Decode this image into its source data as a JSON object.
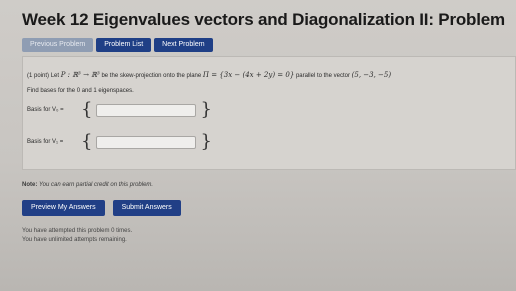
{
  "page_title": "Week 12 Eigenvalues vectors and Diagonalization II: Problem",
  "nav": {
    "previous": "Previous Problem",
    "list": "Problem List",
    "next": "Next Problem"
  },
  "problem": {
    "points": "(1 point)",
    "text_lead": "Let",
    "map": "P : ℝ³ → ℝ³",
    "text_mid": "be the skew-projection onto the plane",
    "plane": "Π = {3x − (4x + 2y) = 0}",
    "text_end": "parallel to the vector",
    "vector": "(5, −3, −5)",
    "find": "Find bases for the 0 and 1 eigenspaces.",
    "basis0_label": "Basis for V₀ =",
    "basis1_label": "Basis for V₁ =",
    "brace_open": "{",
    "brace_close": "}",
    "basis0_value": "",
    "basis1_value": ""
  },
  "note": {
    "label": "Note:",
    "text": "You can earn partial credit on this problem."
  },
  "actions": {
    "preview": "Preview My Answers",
    "submit": "Submit Answers"
  },
  "status": {
    "attempts": "You have attempted this problem 0 times.",
    "unlimited": "You have unlimited attempts remaining."
  },
  "colors": {
    "nav_active": "#1f3f86",
    "nav_disabled": "#8f9db3",
    "button": "#213f86"
  }
}
